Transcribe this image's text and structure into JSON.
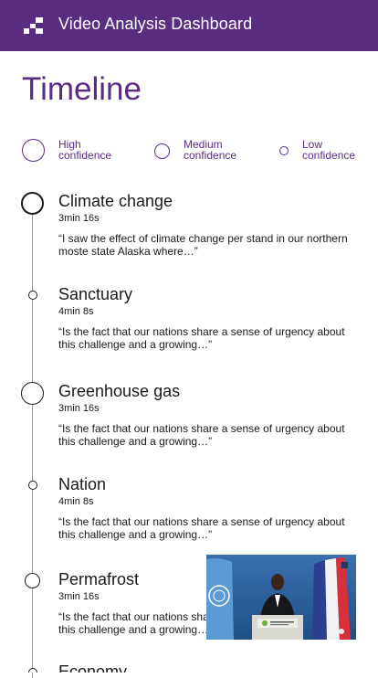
{
  "header": {
    "title": "Video Analysis Dashboard",
    "logo_icon": "grid-blocks-icon",
    "background": "#5a2d82"
  },
  "page": {
    "title": "Timeline"
  },
  "legend": [
    {
      "label_line1": "High",
      "label_line2": "confidence",
      "size": "large"
    },
    {
      "label_line1": "Medium",
      "label_line2": "confidence",
      "size": "medium"
    },
    {
      "label_line1": "Low",
      "label_line2": "confidence",
      "size": "small"
    }
  ],
  "timeline": [
    {
      "title": "Climate change",
      "time": "3min 16s",
      "quote": "“I saw the effect of climate change per stand in our northern moste state Alaska where…”",
      "confidence": "high",
      "active": true
    },
    {
      "title": "Sanctuary",
      "time": "4min 8s",
      "quote": "“Is the fact that our nations share a sense of urgency about this challenge and a growing…”",
      "confidence": "low"
    },
    {
      "title": "Greenhouse gas",
      "time": "3min 16s",
      "quote": "“Is the fact that our nations share a sense of urgency about this challenge and a growing…”",
      "confidence": "high"
    },
    {
      "title": "Nation",
      "time": "4min 8s",
      "quote": "“Is the fact that our nations share a sense of urgency about this challenge and a growing…”",
      "confidence": "low"
    },
    {
      "title": "Permafrost",
      "time": "3min 16s",
      "quote": "“Is the fact that our nations share a sense of urgency about this challenge and a growing…”",
      "confidence": "medium"
    },
    {
      "title": "Economy",
      "time": "",
      "quote": "",
      "confidence": "low"
    }
  ],
  "video": {
    "icon": "video-thumbnail"
  }
}
